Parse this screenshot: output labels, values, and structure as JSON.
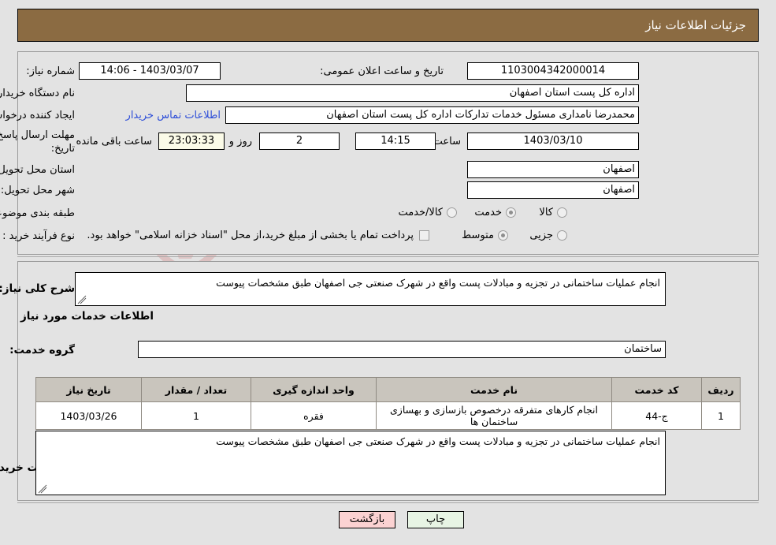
{
  "header": {
    "title": "جزئیات اطلاعات نیاز"
  },
  "form": {
    "need_number_label": "شماره نیاز:",
    "need_number_value": "1103004342000014",
    "announce_datetime_label": "تاریخ و ساعت اعلان عمومی:",
    "announce_datetime_value": "1403/03/07 - 14:06",
    "buyer_org_label": "نام دستگاه خریدار:",
    "buyer_org_value": "اداره کل پست استان اصفهان",
    "requester_label": "ایجاد کننده درخواست:",
    "requester_value": "محمدرضا نامداری مسئول خدمات تدارکات اداره کل پست استان اصفهان",
    "contact_link": "اطلاعات تماس خریدار",
    "deadline_label_line1": "مهلت ارسال پاسخ: تا",
    "deadline_label_line2": "تاریخ:",
    "deadline_date_value": "1403/03/10",
    "hour_label": "ساعت",
    "deadline_time_value": "14:15",
    "days_value": "2",
    "days_label": "روز و",
    "countdown_value": "23:03:33",
    "countdown_label": "ساعت باقی مانده",
    "province_label": "استان محل تحویل:",
    "province_value": "اصفهان",
    "city_label": "شهر محل تحویل:",
    "city_value": "اصفهان",
    "category_label": "طبقه بندی موضوعی:",
    "category_options": [
      {
        "label": "کالا",
        "selected": false
      },
      {
        "label": "خدمت",
        "selected": true
      },
      {
        "label": "کالا/خدمت",
        "selected": false
      }
    ],
    "process_label": "نوع فرآیند خرید :",
    "process_options": [
      {
        "label": "جزیی",
        "selected": false
      },
      {
        "label": "متوسط",
        "selected": true
      }
    ],
    "treasury_checkbox_label": "پرداخت تمام یا بخشی از مبلغ خرید،از محل \"اسناد خزانه اسلامی\" خواهد بود.",
    "treasury_checked": false
  },
  "summary": {
    "label": "شرح کلی نیاز:",
    "value": "انجام عملیات ساختمانی در تجزیه و مبادلات پست واقع در شهرک صنعتی جی اصفهان طبق مشخصات پیوست"
  },
  "services": {
    "section_title": "اطلاعات خدمات مورد نیاز",
    "group_label": "گروه خدمت:",
    "group_value": "ساختمان",
    "columns": [
      "ردیف",
      "کد خدمت",
      "نام خدمت",
      "واحد اندازه گیری",
      "تعداد / مقدار",
      "تاریخ نیاز"
    ],
    "rows": [
      {
        "row": "1",
        "code": "ج-44",
        "name": "انجام کارهای متفرقه درخصوص بازسازی و بهسازی ساختمان ها",
        "unit": "فقره",
        "qty": "1",
        "date": "1403/03/26"
      }
    ]
  },
  "buyer_notes": {
    "label": "توضیحات خریدار:",
    "value": "انجام عملیات ساختمانی در تجزیه و مبادلات پست واقع در شهرک صنعتی جی اصفهان طبق مشخصات پیوست"
  },
  "footer": {
    "print_label": "چاپ",
    "back_label": "بازگشت"
  },
  "watermark": {
    "text": "AriaTender.net"
  },
  "colors": {
    "header_bar": "#8b6b42",
    "page_bg": "#e3e3e3",
    "link": "#2f4fd8",
    "table_header": "#c9c5bd",
    "countdown_bg": "#fbfbe8",
    "print_button": "#e7f4e4",
    "back_button": "#fbd2d2"
  }
}
